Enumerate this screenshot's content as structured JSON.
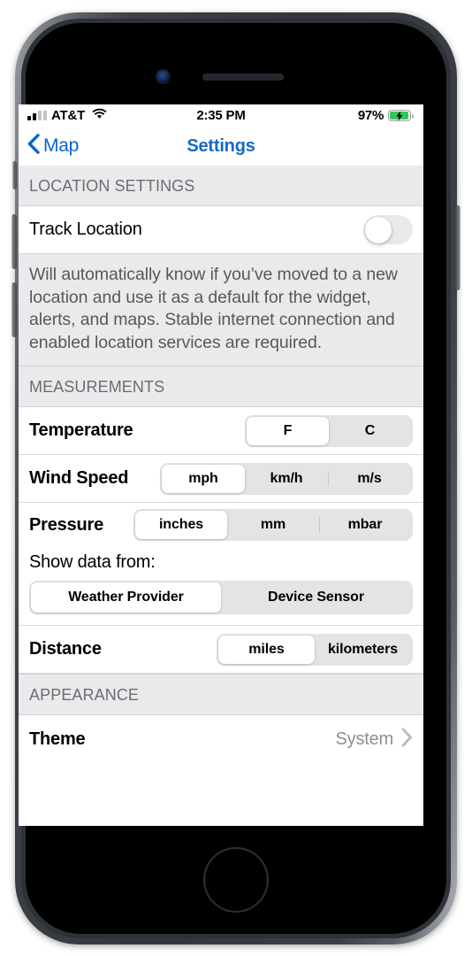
{
  "status_bar": {
    "carrier": "AT&T",
    "time": "2:35 PM",
    "battery_percent": "97%",
    "battery_level": 97,
    "charging": true,
    "signal_bars_filled": 2,
    "signal_bars_total": 4,
    "wifi_icon": "wifi-icon",
    "battery_color": "#34c759"
  },
  "nav": {
    "back_label": "Map",
    "back_icon": "chevron-left-icon",
    "title": "Settings",
    "tint": "#1568c6"
  },
  "sections": {
    "location": {
      "header": "LOCATION SETTINGS",
      "track_location_label": "Track Location",
      "track_location_on": false,
      "footer": "Will automatically know if you’ve moved to a new location and use it as a default for the widget, alerts, and maps. Stable internet connection and enabled location services are required."
    },
    "measurements": {
      "header": "MEASUREMENTS",
      "temperature": {
        "label": "Temperature",
        "options": [
          "F",
          "C"
        ],
        "selected": "F"
      },
      "wind_speed": {
        "label": "Wind Speed",
        "options": [
          "mph",
          "km/h",
          "m/s"
        ],
        "selected": "mph"
      },
      "pressure": {
        "label": "Pressure",
        "options": [
          "inches",
          "mm",
          "mbar"
        ],
        "selected": "inches"
      },
      "data_source": {
        "label": "Show data from:",
        "options": [
          "Weather Provider",
          "Device Sensor"
        ],
        "selected": "Weather Provider"
      },
      "distance": {
        "label": "Distance",
        "options": [
          "miles",
          "kilometers"
        ],
        "selected": "miles"
      }
    },
    "appearance": {
      "header": "APPEARANCE",
      "theme": {
        "label": "Theme",
        "value": "System",
        "chevron_icon": "chevron-right-icon"
      }
    }
  }
}
